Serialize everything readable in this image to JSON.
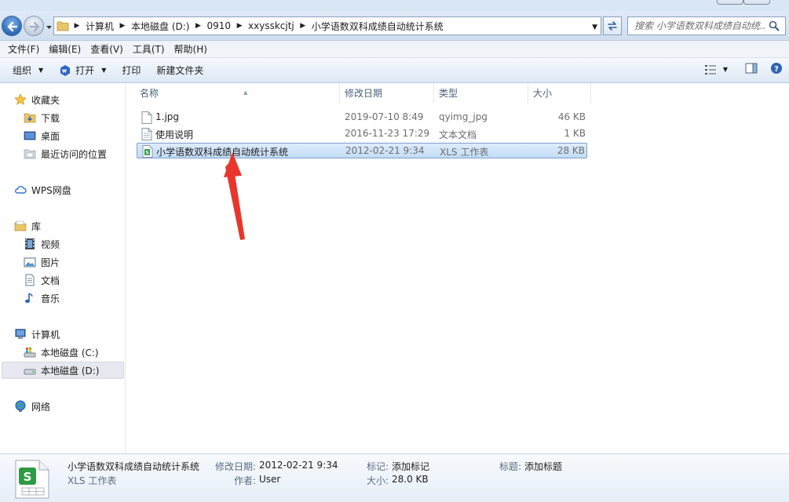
{
  "address": {
    "crumbs": [
      "计算机",
      "本地磁盘 (D:)",
      "0910",
      "xxysskcjtj",
      "小学语数双科成绩自动统计系统"
    ]
  },
  "search": {
    "placeholder": "搜索 小学语数双科成绩自动统..."
  },
  "menu": [
    "文件(F)",
    "编辑(E)",
    "查看(V)",
    "工具(T)",
    "帮助(H)"
  ],
  "toolbar": {
    "organize": "组织",
    "open": "打开",
    "print": "打印",
    "new_folder": "新建文件夹"
  },
  "nav": {
    "favorites": "收藏夹",
    "downloads": "下载",
    "desktop": "桌面",
    "recent": "最近访问的位置",
    "wps": "WPS网盘",
    "library": "库",
    "videos": "视频",
    "pictures": "图片",
    "documents": "文档",
    "music": "音乐",
    "computer": "计算机",
    "drive_c": "本地磁盘 (C:)",
    "drive_d": "本地磁盘 (D:)",
    "network": "网络"
  },
  "columns": {
    "name": "名称",
    "date": "修改日期",
    "type": "类型",
    "size": "大小"
  },
  "files": [
    {
      "name": "1.jpg",
      "date": "2019-07-10 8:49",
      "type": "qyimg_jpg",
      "size": "46 KB",
      "icon": "jpg-file-icon"
    },
    {
      "name": "使用说明",
      "date": "2016-11-23 17:29",
      "type": "文本文档",
      "size": "1 KB",
      "icon": "text-file-icon"
    },
    {
      "name": "小学语数双科成绩自动统计系统",
      "date": "2012-02-21 9:34",
      "type": "XLS 工作表",
      "size": "28 KB",
      "icon": "xls-file-icon"
    }
  ],
  "details": {
    "name": "小学语数双科成绩自动统计系统",
    "type": "XLS 工作表",
    "modified_label": "修改日期:",
    "modified": "2012-02-21 9:34",
    "author_label": "作者:",
    "author": "User",
    "tags_label": "标记:",
    "tags": "添加标记",
    "size_label": "大小:",
    "size": "28.0 KB",
    "title_label": "标题:",
    "title": "添加标题"
  },
  "colors": {
    "selection": "#cce4fa",
    "accent": "#e8362d",
    "xls_green": "#2f9a45"
  }
}
